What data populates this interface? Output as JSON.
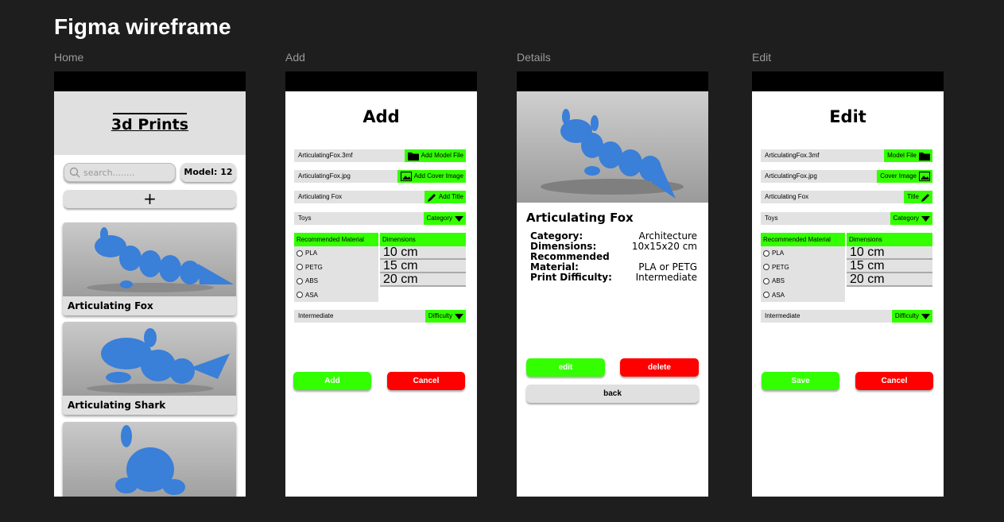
{
  "page_title": "Figma wireframe",
  "frames": {
    "home": {
      "label": "Home",
      "app_title": "3d Prints",
      "search_placeholder": "search........",
      "model_count": "Model: 12",
      "add_symbol": "+",
      "cards": [
        "Articulating Fox",
        "Articulating Shark",
        ""
      ]
    },
    "add": {
      "label": "Add",
      "heading": "Add",
      "model_file": {
        "value": "ArticulatingFox.3mf",
        "button": "Add Model File"
      },
      "cover_image": {
        "value": "ArticulatingFox.jpg",
        "button": "Add Cover Image"
      },
      "title": {
        "value": "Articulating Fox",
        "button": "Add Title"
      },
      "category": {
        "value": "Toys",
        "button": "Category"
      },
      "materials_header": "Recommended Material",
      "dimensions_header": "Dimensions",
      "materials": [
        "PLA",
        "PETG",
        "ABS",
        "ASA"
      ],
      "dimensions": [
        "10 cm",
        "15 cm",
        "20 cm"
      ],
      "difficulty": {
        "value": "Intermediate",
        "button": "Difficulty"
      },
      "submit": "Add",
      "cancel": "Cancel"
    },
    "details": {
      "label": "Details",
      "name": "Articulating Fox",
      "category_label": "Category:",
      "category_value": "Architecture",
      "dimensions_label": "Dimensions:",
      "dimensions_value": "10x15x20 cm",
      "material_label_1": "Recommended",
      "material_label_2": "Material:",
      "material_value": "PLA or PETG",
      "difficulty_label": "Print Difficulty:",
      "difficulty_value": "Intermediate",
      "edit": "edit",
      "delete": "delete",
      "back": "back"
    },
    "edit": {
      "label": "Edit",
      "heading": "Edit",
      "model_file": {
        "value": "ArticulatingFox.3mf",
        "button": "Model File"
      },
      "cover_image": {
        "value": "ArticulatingFox.jpg",
        "button": "Cover Image"
      },
      "title": {
        "value": "Articulating Fox",
        "button": "Title"
      },
      "category": {
        "value": "Toys",
        "button": "Category"
      },
      "materials_header": "Recommended Material",
      "dimensions_header": "Dimensions",
      "materials": [
        "PLA",
        "PETG",
        "ABS",
        "ASA"
      ],
      "dimensions": [
        "10 cm",
        "15 cm",
        "20 cm"
      ],
      "difficulty": {
        "value": "Intermediate",
        "button": "Difficulty"
      },
      "submit": "Save",
      "cancel": "Cancel"
    }
  },
  "colors": {
    "accent_green": "#33ff00",
    "danger_red": "#ff0000",
    "background": "#1e1e1e"
  },
  "icons": [
    "search-icon",
    "folder-icon",
    "image-icon",
    "pencil-icon",
    "caret-down-icon"
  ]
}
